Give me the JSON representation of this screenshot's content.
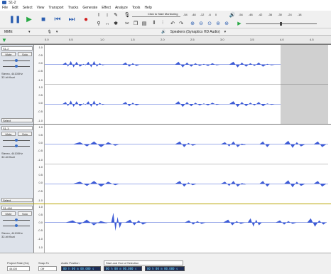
{
  "window": {
    "title": "S1-2"
  },
  "menu": [
    "File",
    "Edit",
    "Select",
    "View",
    "Transport",
    "Tracks",
    "Generate",
    "Effect",
    "Analyze",
    "Tools",
    "Help"
  ],
  "toolbar": {
    "meter_label": "Click to Start Monitoring",
    "meter_ticks": [
      "-54",
      "-48",
      "-42",
      "-18",
      "-12",
      "-6",
      "0"
    ],
    "play_meter_ticks": [
      "-54",
      "-48",
      "-42",
      "-36",
      "-30",
      "-24",
      "-18"
    ],
    "host": "MME",
    "device": "Speakers (Synaptics HD Audio)"
  },
  "ruler": {
    "ticks": [
      "0.0",
      "0.5",
      "1.0",
      "1.5",
      "2.0",
      "2.5",
      "3.0",
      "3.5",
      "4.0",
      "4.5"
    ]
  },
  "tracks": [
    {
      "name": "S1-2",
      "mute": "Mute",
      "solo": "Solo",
      "info": [
        "Stereo, 44100Hz",
        "32-bit float"
      ],
      "select": "Select",
      "scale": [
        "1.0",
        "0.5",
        "0.0",
        "-0.5",
        "-1.0"
      ]
    },
    {
      "name": "S1-3",
      "mute": "Mute",
      "solo": "Solo",
      "info": [
        "Stereo, 44100Hz",
        "32-bit float"
      ],
      "select": "Select",
      "scale": [
        "1.0",
        "0.5",
        "0.0",
        "-0.5",
        "-1.0"
      ]
    },
    {
      "name": "S1-4A1",
      "mute": "Mute",
      "solo": "Solo",
      "info": [
        "Stereo, 44100Hz",
        "32-bit float"
      ],
      "select": "Select",
      "scale": [
        "1.0",
        "0.5",
        "0.0",
        "-0.5",
        "-1.0"
      ]
    }
  ],
  "status": {
    "rate_label": "Project Rate (Hz)",
    "rate_value": "44100",
    "snap_label": "Snap-To",
    "snap_value": "Off",
    "pos_label": "Audio Position",
    "pos_value": "00 h 00 m 00.000 s",
    "sel_label": "Start and End of Selection",
    "sel_start": "00 h 00 m 00.000 s",
    "sel_end": "00 h 00 m 00.000 s"
  },
  "colors": {
    "wave": "#3d5bd6",
    "accent": "#2a5db0",
    "play": "#27a844",
    "record": "#d12020"
  }
}
